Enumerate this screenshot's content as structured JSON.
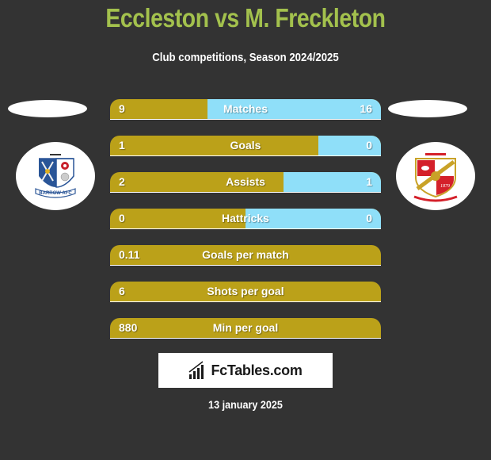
{
  "header": {
    "title": "Eccleston vs M. Freckleton",
    "subtitle": "Club competitions, Season 2024/2025"
  },
  "players": {
    "left": {
      "name": "Eccleston",
      "club_crest": "barrow-afc-crest",
      "crest_text": "BARROW AFC"
    },
    "right": {
      "name": "M. Freckleton",
      "club_crest": "swindon-town-crest",
      "crest_text": "1879"
    }
  },
  "colors": {
    "title": "#a3c14d",
    "left_bar": "#bba119",
    "right_bar": "#8fdff9",
    "background": "#333333"
  },
  "stats": [
    {
      "label": "Matches",
      "left": "9",
      "right": "16",
      "left_share": 0.36
    },
    {
      "label": "Goals",
      "left": "1",
      "right": "0",
      "left_share": 0.77
    },
    {
      "label": "Assists",
      "left": "2",
      "right": "1",
      "left_share": 0.64
    },
    {
      "label": "Hattricks",
      "left": "0",
      "right": "0",
      "left_share": 0.5
    },
    {
      "label": "Goals per match",
      "left": "0.11",
      "right": "",
      "left_share": 1.0
    },
    {
      "label": "Shots per goal",
      "left": "6",
      "right": "",
      "left_share": 1.0
    },
    {
      "label": "Min per goal",
      "left": "880",
      "right": "",
      "left_share": 1.0
    }
  ],
  "brand": {
    "name": "FcTables.com",
    "icon": "bar-chart-icon"
  },
  "date": "13 january 2025"
}
